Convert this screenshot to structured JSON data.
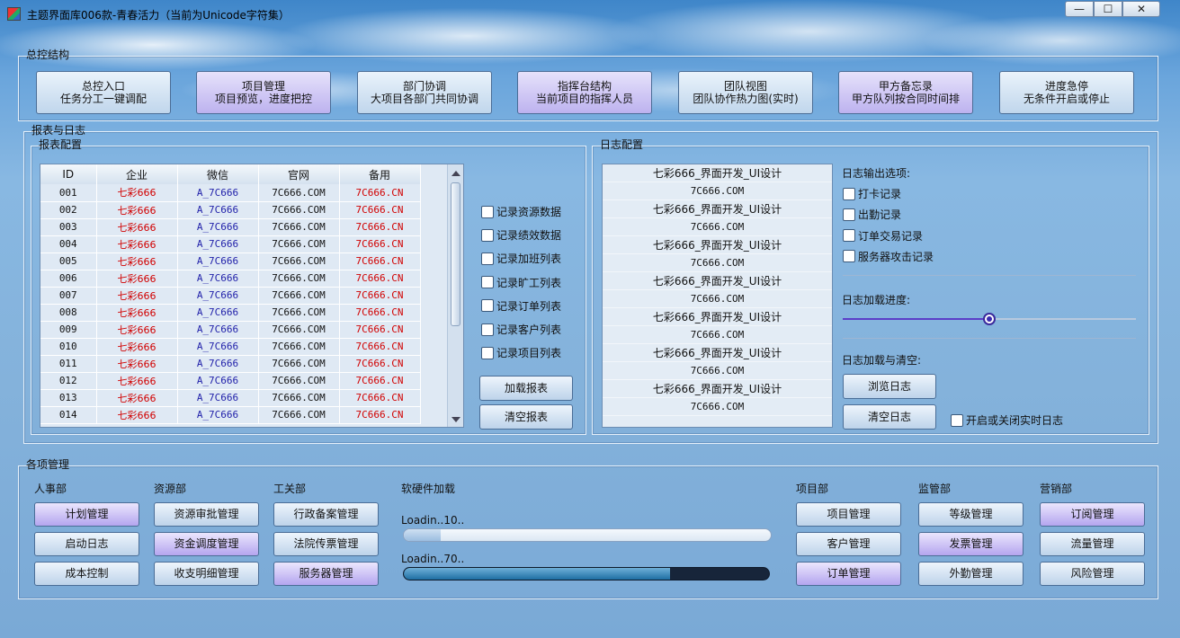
{
  "window": {
    "title": "主题界面库006款-青春活力（当前为Unicode字符集）",
    "min": "—",
    "max": "☐",
    "close": "✕"
  },
  "overview": {
    "legend": "总控结构",
    "buttons": [
      {
        "line1": "总控入口",
        "line2": "任务分工一键调配",
        "style": "normal"
      },
      {
        "line1": "项目管理",
        "line2": "项目预览，进度把控",
        "style": "alt"
      },
      {
        "line1": "部门协调",
        "line2": "大项目各部门共同协调",
        "style": "normal"
      },
      {
        "line1": "指挥台结构",
        "line2": "当前项目的指挥人员",
        "style": "alt"
      },
      {
        "line1": "团队视图",
        "line2": "团队协作热力图(实时)",
        "style": "normal"
      },
      {
        "line1": "甲方备忘录",
        "line2": "甲方队列按合同时间排",
        "style": "alt"
      },
      {
        "line1": "进度急停",
        "line2": "无条件开启或停止",
        "style": "normal"
      }
    ]
  },
  "reports": {
    "legend": "报表与日志",
    "config_legend": "报表配置",
    "columns": [
      "ID",
      "企业",
      "微信",
      "官网",
      "备用"
    ],
    "rows": [
      [
        "001",
        "七彩666",
        "A_7C666",
        "7C666.COM",
        "7C666.CN"
      ],
      [
        "002",
        "七彩666",
        "A_7C666",
        "7C666.COM",
        "7C666.CN"
      ],
      [
        "003",
        "七彩666",
        "A_7C666",
        "7C666.COM",
        "7C666.CN"
      ],
      [
        "004",
        "七彩666",
        "A_7C666",
        "7C666.COM",
        "7C666.CN"
      ],
      [
        "005",
        "七彩666",
        "A_7C666",
        "7C666.COM",
        "7C666.CN"
      ],
      [
        "006",
        "七彩666",
        "A_7C666",
        "7C666.COM",
        "7C666.CN"
      ],
      [
        "007",
        "七彩666",
        "A_7C666",
        "7C666.COM",
        "7C666.CN"
      ],
      [
        "008",
        "七彩666",
        "A_7C666",
        "7C666.COM",
        "7C666.CN"
      ],
      [
        "009",
        "七彩666",
        "A_7C666",
        "7C666.COM",
        "7C666.CN"
      ],
      [
        "010",
        "七彩666",
        "A_7C666",
        "7C666.COM",
        "7C666.CN"
      ],
      [
        "011",
        "七彩666",
        "A_7C666",
        "7C666.COM",
        "7C666.CN"
      ],
      [
        "012",
        "七彩666",
        "A_7C666",
        "7C666.COM",
        "7C666.CN"
      ],
      [
        "013",
        "七彩666",
        "A_7C666",
        "7C666.COM",
        "7C666.CN"
      ],
      [
        "014",
        "七彩666",
        "A_7C666",
        "7C666.COM",
        "7C666.CN"
      ]
    ],
    "checks": [
      "记录资源数据",
      "记录绩效数据",
      "记录加班列表",
      "记录旷工列表",
      "记录订单列表",
      "记录客户列表",
      "记录项目列表"
    ],
    "load_button": "加载报表",
    "clear_button": "清空报表"
  },
  "logs": {
    "legend": "日志配置",
    "lines": [
      "七彩666_界面开发_UI设计",
      "7C666.COM",
      "七彩666_界面开发_UI设计",
      "7C666.COM",
      "七彩666_界面开发_UI设计",
      "7C666.COM",
      "七彩666_界面开发_UI设计",
      "7C666.COM",
      "七彩666_界面开发_UI设计",
      "7C666.COM",
      "七彩666_界面开发_UI设计",
      "7C666.COM",
      "七彩666_界面开发_UI设计",
      "7C666.COM"
    ],
    "output_title": "日志输出选项:",
    "output_options": [
      "打卡记录",
      "出勤记录",
      "订单交易记录",
      "服务器攻击记录"
    ],
    "progress_title": "日志加载进度:",
    "progress_value": 0.5,
    "load_clear_title": "日志加载与清空:",
    "browse_button": "浏览日志",
    "clear_button": "清空日志",
    "realtime_label": "开启或关闭实时日志"
  },
  "management": {
    "legend": "各项管理",
    "hr": {
      "title": "人事部",
      "buttons": [
        {
          "label": "计划管理",
          "style": "alt"
        },
        {
          "label": "启动日志",
          "style": "normal"
        },
        {
          "label": "成本控制",
          "style": "normal"
        }
      ]
    },
    "resource": {
      "title": "资源部",
      "buttons": [
        {
          "label": "资源审批管理",
          "style": "normal"
        },
        {
          "label": "资金调度管理",
          "style": "alt"
        },
        {
          "label": "收支明细管理",
          "style": "normal"
        }
      ]
    },
    "engineering": {
      "title": "工关部",
      "buttons": [
        {
          "label": "行政备案管理",
          "style": "normal"
        },
        {
          "label": "法院传票管理",
          "style": "normal"
        },
        {
          "label": "服务器管理",
          "style": "alt"
        }
      ]
    },
    "loading": {
      "title": "软硬件加载",
      "bar1_label": "Loadin..10..",
      "bar1_value": 0.1,
      "bar2_label": "Loadin..70..",
      "bar2_value": 0.73
    },
    "project": {
      "title": "项目部",
      "buttons": [
        {
          "label": "项目管理",
          "style": "normal"
        },
        {
          "label": "客户管理",
          "style": "normal"
        },
        {
          "label": "订单管理",
          "style": "alt"
        }
      ]
    },
    "supervision": {
      "title": "监管部",
      "buttons": [
        {
          "label": "等级管理",
          "style": "normal"
        },
        {
          "label": "发票管理",
          "style": "alt"
        },
        {
          "label": "外勤管理",
          "style": "normal"
        }
      ]
    },
    "marketing": {
      "title": "营销部",
      "buttons": [
        {
          "label": "订阅管理",
          "style": "alt"
        },
        {
          "label": "流量管理",
          "style": "normal"
        },
        {
          "label": "风险管理",
          "style": "normal"
        }
      ]
    }
  }
}
